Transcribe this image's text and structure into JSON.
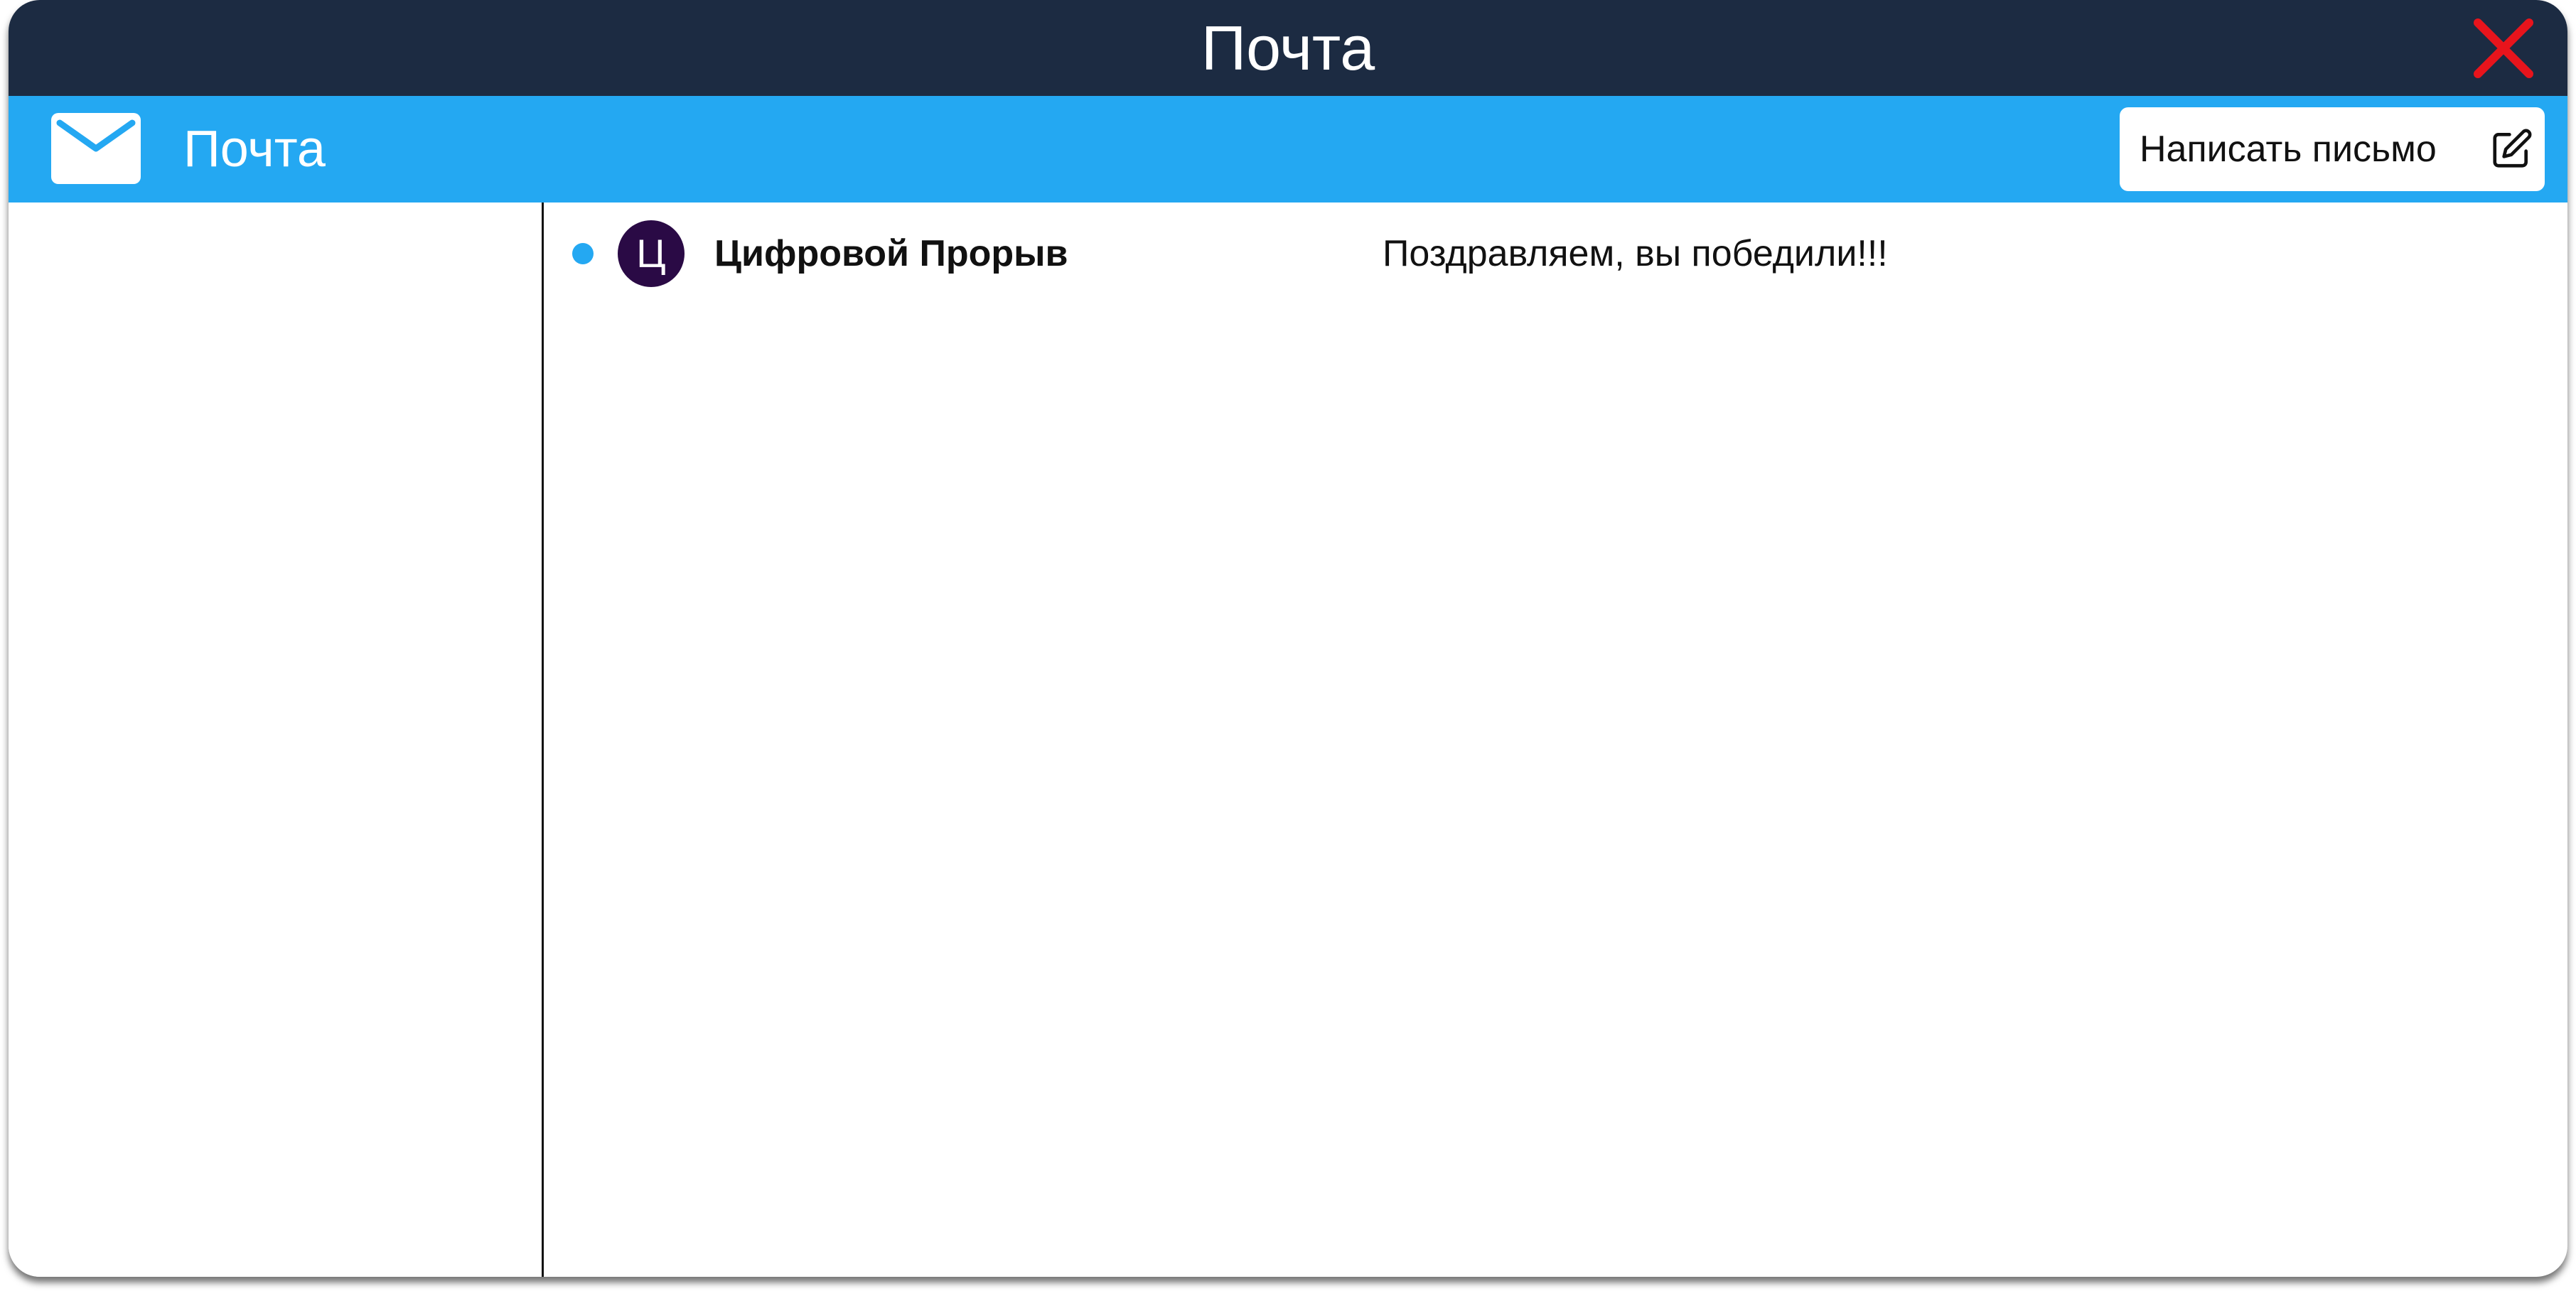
{
  "window": {
    "title": "Почта"
  },
  "toolbar": {
    "title": "Почта",
    "compose_label": "Написать письмо"
  },
  "mail_list": [
    {
      "unread": true,
      "avatar_letter": "Ц",
      "sender": "Цифровой Прорыв",
      "subject": "Поздравляем, вы победили!!!"
    }
  ],
  "icons": {
    "close": "close-icon",
    "mail": "mail-icon",
    "compose": "pencil-edit-icon"
  },
  "colors": {
    "titlebar": "#1c2b42",
    "toolbar": "#24a8f2",
    "close": "#e8141c",
    "avatar": "#2a0a45",
    "unread_dot": "#24a8f2"
  }
}
